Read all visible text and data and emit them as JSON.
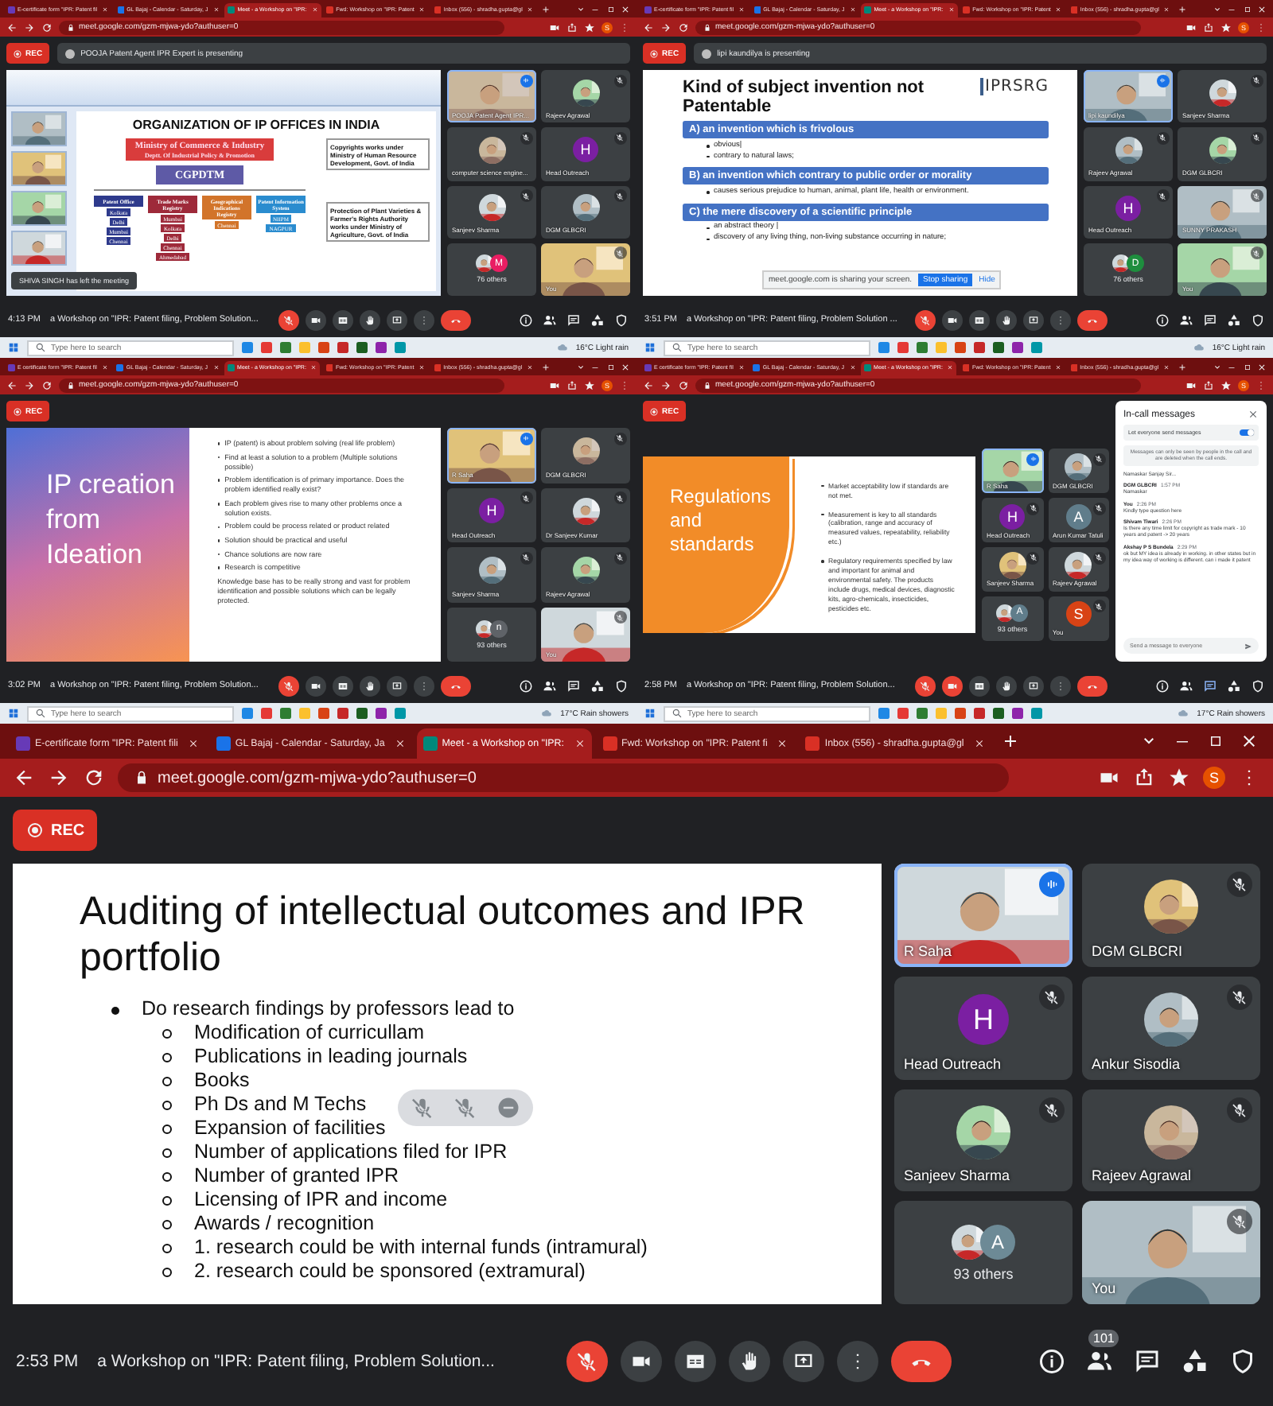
{
  "screens": [
    {
      "tabs": [
        {
          "kind": "forms",
          "title": "E-certificate form \"IPR: Patent fil",
          "selected": false
        },
        {
          "kind": "calendar",
          "title": "GL Bajaj - Calendar - Saturday, J",
          "selected": false
        },
        {
          "kind": "meet",
          "title": "Meet - a Workshop on \"IPR:",
          "selected": true
        },
        {
          "kind": "gmail",
          "title": "Fwd: Workshop on \"IPR: Patent",
          "selected": false
        },
        {
          "kind": "gmail",
          "title": "Inbox (556) - shradha.gupta@gl",
          "selected": false
        }
      ],
      "url": "meet.google.com/gzm-mjwa-ydo?authuser=0",
      "profile": "S",
      "rec": "REC",
      "presenting": "POOJA Patent Agent IPR Expert is presenting",
      "slide": {
        "kind": "org_chart",
        "title": "ORGANIZATION OF IP OFFICES IN INDIA",
        "ministry": "Ministry of Commerce & Industry",
        "dept": "Deptt. Of Industrial Policy & Promotion",
        "head": "CGPDTM",
        "branches": [
          {
            "name": "Patent Office",
            "color": "#2e3a8c",
            "offices": [
              "Kolkata",
              "Delhi",
              "Mumbai",
              "Chennai"
            ]
          },
          {
            "name": "Trade Marks Registry",
            "color": "#9e2a3a",
            "offices": [
              "Mumbai",
              "Kolkata",
              "Delhi",
              "Chennai",
              "Ahmedabad"
            ]
          },
          {
            "name": "Geographical Indications Registry",
            "color": "#d2742a",
            "offices": [
              "Chennai"
            ]
          },
          {
            "name": "Patent Information System",
            "color": "#2a8ccf",
            "offices": [
              "NIIPM",
              "NAGPUR"
            ]
          }
        ],
        "notes": [
          "Copyrights works under Ministry of Human Resource Development, Govt. of India",
          "Protection of Plant Varieties & Farmer's Rights Authority works under Ministry of Agriculture, Govt. of India"
        ]
      },
      "toast": "SHIVA SINGH has left the meeting",
      "tiles": [
        {
          "kind": "video",
          "name": "POOJA Patent Agent IPR...",
          "speaking": true
        },
        {
          "name": "Rajeev Agrawal",
          "speaking": false
        },
        {
          "name": "computer science engine...",
          "speaking": false
        },
        {
          "kind": "letter",
          "name": "Head Outreach",
          "letter": "H",
          "color": "#7b1fa2",
          "speaking": false
        },
        {
          "name": "Sanjeev Sharma",
          "speaking": false
        },
        {
          "name": "DGM GLBCRI",
          "speaking": false
        },
        {
          "kind": "others",
          "name": "76 others",
          "letter": "M",
          "color": "#e91e63"
        },
        {
          "kind": "video",
          "name": "You",
          "speaking": false
        }
      ],
      "time": "4:13 PM",
      "meeting": "a Workshop on \"IPR: Patent filing, Problem Solution...",
      "camera_off": false,
      "taskbar": {
        "search": "Type here to search",
        "weather": "16°C Light rain"
      }
    },
    {
      "tabs": [
        {
          "kind": "forms",
          "title": "E-certificate form \"IPR: Patent fil",
          "selected": false
        },
        {
          "kind": "calendar",
          "title": "GL Bajaj - Calendar - Saturday, J",
          "selected": false
        },
        {
          "kind": "meet",
          "title": "Meet - a Workshop on \"IPR:",
          "selected": true
        },
        {
          "kind": "gmail",
          "title": "Fwd: Workshop on \"IPR: Patent",
          "selected": false
        },
        {
          "kind": "gmail",
          "title": "Inbox (556) - shradha.gupta@gl",
          "selected": false
        }
      ],
      "url": "meet.google.com/gzm-mjwa-ydo?authuser=0",
      "profile": "S",
      "rec": "REC",
      "presenting": "lipi kaundilya is presenting",
      "slide": {
        "kind": "sections",
        "title": "Kind of subject invention not Patentable",
        "logo": "IPRSRG",
        "sections": [
          {
            "heading": "A) an invention which is frivolous",
            "bullets": [
              "obvious|",
              "contrary to natural laws;"
            ]
          },
          {
            "heading": "B)  an invention which contrary to public order or morality",
            "bullets": [
              "causes serious prejudice to human, animal, plant life, health or environment."
            ]
          },
          {
            "heading": "C) the mere discovery of a scientific principle",
            "bullets": [
              "an abstract theory |",
              "discovery of any living thing, non-living substance occurring in nature;"
            ]
          }
        ],
        "share_bar": {
          "text": "meet.google.com is sharing your screen.",
          "stop": "Stop sharing",
          "hide": "Hide"
        }
      },
      "tiles": [
        {
          "kind": "video",
          "name": "lipi kaundilya",
          "speaking": true
        },
        {
          "name": "Sanjeev Sharma",
          "speaking": false
        },
        {
          "name": "Rajeev Agrawal",
          "speaking": false
        },
        {
          "name": "DGM GLBCRI",
          "speaking": false
        },
        {
          "kind": "letter",
          "name": "Head Outreach",
          "letter": "H",
          "color": "#7b1fa2",
          "speaking": false
        },
        {
          "kind": "video",
          "name": "SUNNY PRAKASH",
          "speaking": false
        },
        {
          "kind": "others",
          "name": "76 others",
          "letter": "D",
          "color": "#1e8e3e"
        },
        {
          "kind": "video",
          "name": "You",
          "speaking": false
        }
      ],
      "time": "3:51 PM",
      "meeting": "a Workshop on \"IPR: Patent filing, Problem Solution ...",
      "camera_off": false,
      "taskbar": {
        "search": "Type here to search",
        "weather": "16°C Light rain"
      }
    },
    {
      "tabs": [
        {
          "kind": "forms",
          "title": "E certificate form \"IPR: Patent fil",
          "selected": false
        },
        {
          "kind": "calendar",
          "title": "GL Bajaj - Calendar - Saturday, J",
          "selected": false
        },
        {
          "kind": "meet",
          "title": "Meet - a Workshop on \"IPR:",
          "selected": true
        },
        {
          "kind": "gmail",
          "title": "Fwd: Workshop on \"IPR: Patent",
          "selected": false
        },
        {
          "kind": "gmail",
          "title": "Inbox (556) - shradha.gupta@gl",
          "selected": false
        }
      ],
      "url": "meet.google.com/gzm-mjwa-ydo?authuser=0",
      "profile": "S",
      "rec": "REC",
      "slide": {
        "kind": "gradient_split",
        "title": "IP creation from Ideation",
        "bullets": [
          "IP (patent) is about problem solving (real life problem)",
          "Find at least a solution to a problem (Multiple solutions possible)",
          "Problem identification is of primary importance. Does the problem identified really exist?",
          "Each problem gives rise to many other problems once a solution exists.",
          "Problem could be process related or product related",
          "Solution should be practical and useful",
          "Chance solutions are now rare",
          "Research is competitive"
        ],
        "paragraph": "Knowledge base has to be really strong and vast for problem identification and possible solutions which can be legally protected."
      },
      "tiles": [
        {
          "kind": "video",
          "name": "R Saha",
          "speaking": true
        },
        {
          "name": "DGM GLBCRI",
          "speaking": false
        },
        {
          "kind": "letter",
          "name": "Head Outreach",
          "letter": "H",
          "color": "#7b1fa2",
          "speaking": false
        },
        {
          "name": "Dr Sanjeev Kumar",
          "speaking": false
        },
        {
          "name": "Sanjeev Sharma",
          "speaking": false
        },
        {
          "name": "Rajeev Agrawal",
          "speaking": false
        },
        {
          "kind": "others",
          "name": "93 others",
          "letter": "n",
          "color": "#5f6368"
        },
        {
          "kind": "video",
          "name": "You",
          "speaking": false
        }
      ],
      "time": "3:02 PM",
      "meeting": "a Workshop on \"IPR: Patent filing, Problem Solution...",
      "camera_off": false,
      "taskbar": {
        "search": "Type here to search",
        "weather": "17°C Rain showers"
      }
    },
    {
      "tabs": [
        {
          "kind": "forms",
          "title": "E certificate form \"IPR: Patent fil",
          "selected": false
        },
        {
          "kind": "calendar",
          "title": "GL Bajaj - Calendar - Saturday, J",
          "selected": false
        },
        {
          "kind": "meet",
          "title": "Meet - a Workshop on \"IPR:",
          "selected": true
        },
        {
          "kind": "gmail",
          "title": "Fwd: Workshop on \"IPR: Patent",
          "selected": false
        },
        {
          "kind": "gmail",
          "title": "Inbox (556) - shradha.gupta@gl",
          "selected": false
        }
      ],
      "url": "meet.google.com/gzm-mjwa-ydo?authuser=0",
      "profile": "S",
      "rec": "REC",
      "slide": {
        "kind": "orange_arc",
        "title": "Regulations and standards",
        "bullets": [
          "Market acceptability low if standards are not met.",
          "Measurement is key to all standards (calibration, range and accuracy of measured values, repeatability, reliability etc.)",
          "Regulatory requirements specified by law and important for animal and environmental safety. The products include drugs, medical devices, diagnostic kits, agro-chemicals, insecticides, pesticides etc."
        ]
      },
      "tiles": [
        {
          "kind": "video",
          "name": "R Saha",
          "speaking": true
        },
        {
          "name": "DGM GLBCRI",
          "speaking": false
        },
        {
          "kind": "letter",
          "name": "Head Outreach",
          "letter": "H",
          "color": "#7b1fa2",
          "speaking": false
        },
        {
          "kind": "letter",
          "name": "Arun Kumar Tatuli",
          "letter": "A",
          "color": "#607d8b",
          "speaking": false
        },
        {
          "name": "Sanjeev Sharma",
          "speaking": false
        },
        {
          "name": "Rajeev Agrawal",
          "speaking": false
        },
        {
          "kind": "others",
          "name": "93 others",
          "letter": "A",
          "color": "#607d8b"
        },
        {
          "kind": "letter",
          "name": "You",
          "letter": "S",
          "color": "#d84315",
          "speaking": false
        }
      ],
      "chat": {
        "title": "In-call messages",
        "toggle_label": "Let everyone send messages",
        "toggle_on": true,
        "notice": "Messages can only be seen by people in the call and are deleted when the call ends.",
        "messages": [
          {
            "text": "Namaskar Sanjay Sir..."
          },
          {
            "sender": "DGM GLBCRI",
            "time": "1:57 PM",
            "text": "Namaskar"
          },
          {
            "sender": "You",
            "time": "2:26 PM",
            "text": "Kindly type question here"
          },
          {
            "sender": "Shivam Tiwari",
            "time": "2:26 PM",
            "text": "Is there any time limit for copyright as trade mark - 10 years and patent -> 20 years"
          },
          {
            "sender": "Akshay P S Bundela",
            "time": "2:29 PM",
            "text": "ok but MY idea is already in working. in other states but in my idea way of working is different. can i made it patent"
          }
        ],
        "placeholder": "Send a message to everyone"
      },
      "time": "2:58 PM",
      "meeting": "a Workshop on \"IPR: Patent filing, Problem Solution...",
      "camera_off": true,
      "taskbar": {
        "search": "Type here to search",
        "weather": "17°C Rain showers"
      }
    },
    {
      "tabs": [
        {
          "kind": "forms",
          "title": "E-certificate form \"IPR: Patent fili",
          "selected": false
        },
        {
          "kind": "calendar",
          "title": "GL Bajaj - Calendar - Saturday, Ja",
          "selected": false
        },
        {
          "kind": "meet",
          "title": "Meet - a Workshop on \"IPR:",
          "selected": true
        },
        {
          "kind": "gmail",
          "title": "Fwd: Workshop on \"IPR: Patent fi",
          "selected": false
        },
        {
          "kind": "gmail",
          "title": "Inbox (556) - shradha.gupta@gl",
          "selected": false
        }
      ],
      "url": "meet.google.com/gzm-mjwa-ydo?authuser=0",
      "profile": "S",
      "rec": "REC",
      "slide": {
        "kind": "bullets",
        "title": "Auditing of intellectual outcomes and IPR portfolio",
        "items": [
          {
            "text": "Do research findings by professors lead to",
            "children": [
              {
                "text": "Modification of curricullam"
              },
              {
                "text": "Publications in leading journals"
              },
              {
                "text": "Books"
              },
              {
                "text": "Ph Ds and M Techs"
              },
              {
                "text": "Expansion of facilities"
              },
              {
                "text": "Number of applications filed for IPR"
              },
              {
                "text": "Number of granted IPR"
              },
              {
                "text": "Licensing of IPR and income"
              },
              {
                "text": "Awards / recognition"
              },
              {
                "text": "1. research could be with internal funds (intramural)"
              },
              {
                "text": "2. research could be sponsored (extramural)"
              }
            ]
          }
        ],
        "floating_controls": true
      },
      "tiles": [
        {
          "kind": "video",
          "name": "R Saha",
          "speaking": true
        },
        {
          "name": "DGM GLBCRI",
          "speaking": false
        },
        {
          "kind": "letter",
          "name": "Head Outreach",
          "letter": "H",
          "color": "#7b1fa2",
          "speaking": false
        },
        {
          "name": "Ankur Sisodia",
          "speaking": false
        },
        {
          "name": "Sanjeev Sharma",
          "speaking": false
        },
        {
          "name": "Rajeev Agrawal",
          "speaking": false
        },
        {
          "kind": "others",
          "name": "93 others",
          "letter": "A",
          "color": "#6d8a96"
        },
        {
          "kind": "video",
          "name": "You",
          "speaking": false
        }
      ],
      "time": "2:53 PM",
      "meeting": "a Workshop on \"IPR: Patent filing, Problem Solution...",
      "camera_off": false,
      "people_count": "101"
    }
  ]
}
